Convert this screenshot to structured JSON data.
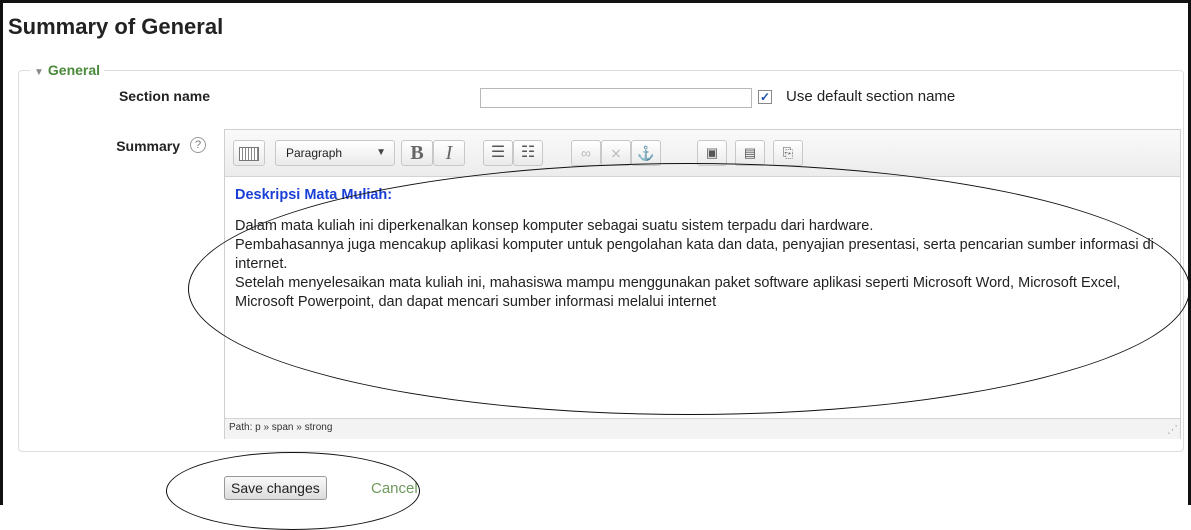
{
  "page": {
    "title": "Summary of General"
  },
  "fieldset": {
    "legend": "General"
  },
  "section": {
    "label": "Section name",
    "value": "",
    "use_default": true,
    "use_default_label": "Use default section name"
  },
  "summary": {
    "label": "Summary",
    "help_glyph": "?",
    "toolbar": {
      "format_select": "Paragraph",
      "bold": "B",
      "italic": "I"
    },
    "content": {
      "heading": "Deskripsi Mata Muliah:",
      "lines": [
        "Dalam mata kuliah ini diperkenalkan konsep komputer  sebagai  suatu sistem terpadu dari hardware.",
        "Pembahasannya juga mencakup aplikasi komputer untuk pengolahan kata dan data, penyajian presentasi, serta pencarian sumber informasi  di internet.",
        "Setelah menyelesaikan mata kuliah ini, mahasiswa mampu menggunakan paket software aplikasi seperti Microsoft Word, Microsoft Excel, Microsoft  Powerpoint, dan  dapat mencari sumber informasi melalui  internet"
      ]
    },
    "path": "Path: p » span » strong"
  },
  "actions": {
    "save_label": "Save changes",
    "cancel_label": "Cancel"
  },
  "icons": {
    "help": "question-circle-icon",
    "bullet_list": "bullet-list-icon",
    "numbered_list": "numbered-list-icon",
    "link": "link-icon",
    "unlink": "unlink-icon",
    "anchor": "anchor-icon",
    "image": "image-icon",
    "media": "media-icon",
    "paste": "paste-icon"
  },
  "colors": {
    "legend": "#4a8a3b",
    "heading": "#1a3fd6",
    "cancel": "#6f9a5c"
  }
}
